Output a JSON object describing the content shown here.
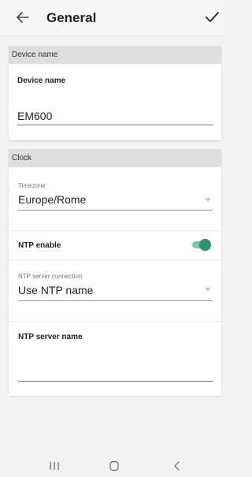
{
  "appbar": {
    "title": "General",
    "back_icon": "arrow-left-icon",
    "confirm_icon": "check-icon"
  },
  "device_name_section": {
    "header": "Device name",
    "field_label": "Device name",
    "field_value": "EM600"
  },
  "clock_section": {
    "header": "Clock",
    "timezone": {
      "label": "Timezone",
      "value": "Europe/Rome"
    },
    "ntp_enable": {
      "label": "NTP enable",
      "enabled": true
    },
    "ntp_server_connection": {
      "label": "NTP server connection",
      "value": "Use NTP name"
    },
    "ntp_server_name": {
      "label": "NTP server name",
      "value": ""
    }
  },
  "navbar": {
    "icons": [
      "recent-apps-icon",
      "home-icon",
      "back-icon"
    ]
  },
  "colors": {
    "accent": "#2e9176",
    "accent_light": "#7fc5ae",
    "section_header_bg": "#dedede",
    "page_bg": "#f2f2f2"
  }
}
